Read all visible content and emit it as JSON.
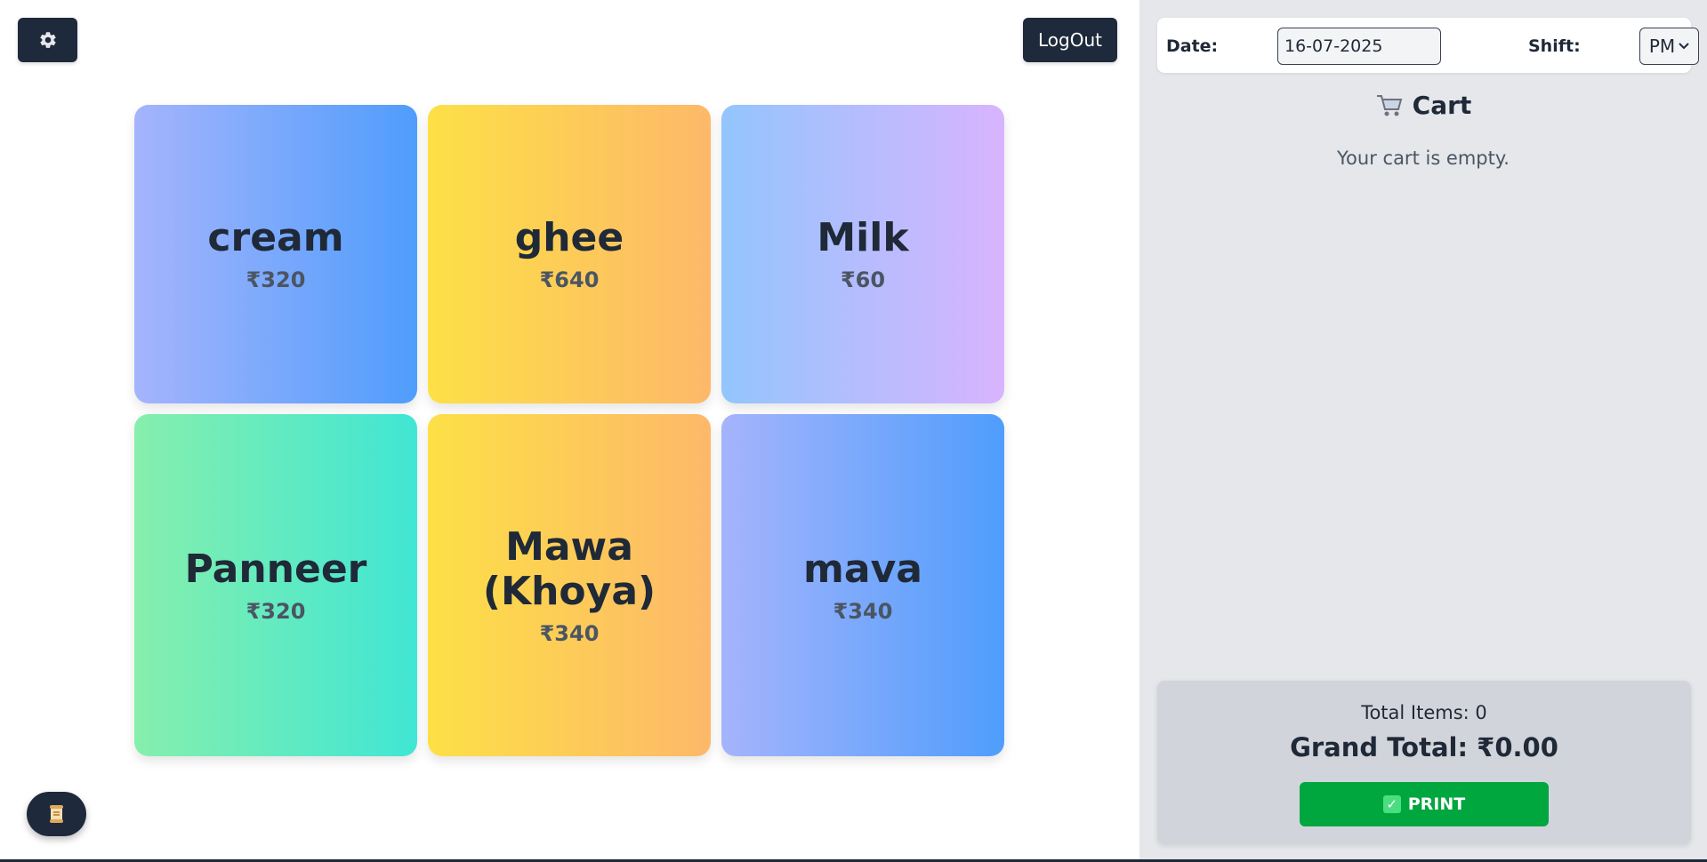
{
  "header": {
    "settings_icon": "gear-icon",
    "logout_label": "LogOut"
  },
  "products": [
    {
      "name": "cream",
      "price": "₹320"
    },
    {
      "name": "ghee",
      "price": "₹640"
    },
    {
      "name": "Milk",
      "price": "₹60"
    },
    {
      "name": "Panneer",
      "price": "₹320"
    },
    {
      "name": "Mawa (Khoya)",
      "price": "₹340"
    },
    {
      "name": "mava",
      "price": "₹340"
    }
  ],
  "footer": {
    "history_icon": "scroll-icon"
  },
  "sidebar": {
    "date_label": "Date:",
    "date_value": "16-07-2025",
    "shift_label": "Shift:",
    "shift_value": "PM",
    "cart_icon": "cart-icon",
    "cart_title": "Cart",
    "cart_empty": "Your cart is empty.",
    "total_items": "Total Items: 0",
    "grand_total": "Grand Total: ₹0.00",
    "print_icon": "checkmark-icon",
    "print_label": "PRINT"
  },
  "colors": {
    "dark_button": "#1e293b",
    "print_green": "#00a63e",
    "sidebar_bg": "#e5e7eb",
    "summary_bg": "#d1d5db"
  }
}
